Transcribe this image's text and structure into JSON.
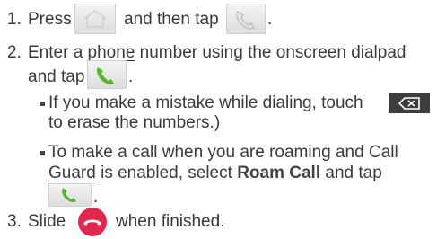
{
  "steps": {
    "step1": {
      "number": "1.",
      "text_a": "Press",
      "text_b": "and then tap",
      "text_c": ".",
      "icons": [
        "home-key-icon",
        "phone-handset-outline-icon"
      ]
    },
    "step2": {
      "number": "2.",
      "line1_a": "Enter a ",
      "line1_underlined": "phone",
      "line1_b": " number using the onscreen dialpad",
      "line2_a": "and tap",
      "line2_b": ".",
      "icons": [
        "call-green-icon"
      ],
      "bullets": [
        {
          "line1": "If you make a mistake while dialing, touch",
          "line2": "to erase the numbers.)",
          "icon": "backspace-icon"
        },
        {
          "line1": "To make a call when you are roaming and Call",
          "line2_underlined": "Guard",
          "line2_a": " is enabled, select ",
          "line2_bold": "Roam Call",
          "line2_b": " and tap",
          "line3": ".",
          "icon": "call-green-icon"
        }
      ]
    },
    "step3": {
      "number": "3.",
      "text_a": "Slide",
      "text_b": "when finished.",
      "icons": [
        "end-call-red-icon"
      ]
    }
  },
  "colors": {
    "call_green": "#5ab52a",
    "end_red": "#e3264d",
    "backspace_bg": "#3d3d3d"
  }
}
